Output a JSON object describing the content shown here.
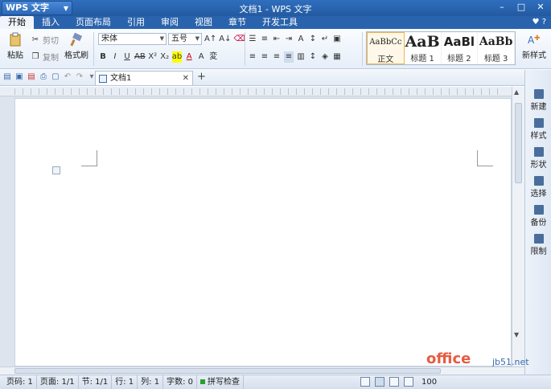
{
  "window": {
    "app_button": "WPS 文字",
    "title": "文档1 - WPS 文字",
    "controls": [
      "minimize",
      "maximize",
      "close"
    ]
  },
  "menu": {
    "tabs": [
      "开始",
      "插入",
      "页面布局",
      "引用",
      "审阅",
      "视图",
      "章节",
      "开发工具"
    ],
    "active": "开始"
  },
  "ribbon": {
    "paste_label": "粘贴",
    "cut_label": "剪切",
    "copy_label": "复制",
    "format_painter_label": "格式刷",
    "font_name": "宋体",
    "font_size": "五号",
    "styles": [
      {
        "sample": "AaBbCc",
        "label": "正文"
      },
      {
        "sample": "AaB",
        "label": "标题 1"
      },
      {
        "sample": "AaBl",
        "label": "标题 2"
      },
      {
        "sample": "AaBb",
        "label": "标题 3"
      }
    ],
    "new_style_label": "新样式"
  },
  "doc_tab": {
    "label": "文档1"
  },
  "right_pane": {
    "items": [
      "新建",
      "样式",
      "形状",
      "选择",
      "备份",
      "限制"
    ]
  },
  "status": {
    "page_code": "页码: 1",
    "page": "页面: 1/1",
    "section": "节: 1/1",
    "row": "行: 1",
    "col": "列: 1",
    "word_count": "字数: 0",
    "spell": "拼写检查",
    "zoom": "100"
  },
  "watermark": {
    "brand": "office",
    "site": "jb51.net"
  },
  "colors": {
    "title_bar": "#2a63ad",
    "ribbon": "#e6eef8",
    "status_ok": "#27a02a"
  }
}
